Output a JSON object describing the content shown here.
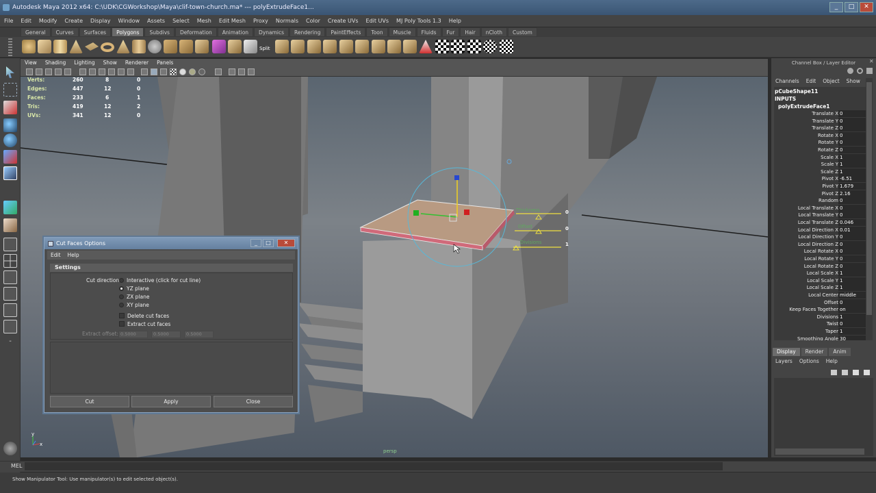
{
  "window": {
    "title": "Autodesk Maya 2012 x64: C:\\UDK\\CGWorkshop\\Maya\\clif-town-church.ma*  ---  polyExtrudeFace1...",
    "controls": [
      "_",
      "□",
      "✕"
    ]
  },
  "menubar": [
    "File",
    "Edit",
    "Modify",
    "Create",
    "Display",
    "Window",
    "Assets",
    "Select",
    "Mesh",
    "Edit Mesh",
    "Proxy",
    "Normals",
    "Color",
    "Create UVs",
    "Edit UVs",
    "MJ Poly Tools 1.3",
    "Help"
  ],
  "shelf_tabs": [
    "General",
    "Curves",
    "Surfaces",
    "Polygons",
    "Subdivs",
    "Deformation",
    "Animation",
    "Dynamics",
    "Rendering",
    "PaintEffects",
    "Toon",
    "Muscle",
    "Fluids",
    "Fur",
    "Hair",
    "nCloth",
    "Custom"
  ],
  "active_shelf_tab": "Polygons",
  "shelf_split_label": "Split",
  "viewport": {
    "menu": [
      "View",
      "Shading",
      "Lighting",
      "Show",
      "Renderer",
      "Panels"
    ],
    "camera_label": "persp",
    "hud": {
      "rows": [
        {
          "label": "Verts:",
          "a": "260",
          "b": "8",
          "c": "0"
        },
        {
          "label": "Edges:",
          "a": "447",
          "b": "12",
          "c": "0"
        },
        {
          "label": "Faces:",
          "a": "233",
          "b": "6",
          "c": "1"
        },
        {
          "label": "Tris:",
          "a": "419",
          "b": "12",
          "c": "2"
        },
        {
          "label": "UVs:",
          "a": "341",
          "b": "12",
          "c": "0"
        }
      ]
    },
    "manip": {
      "labels": [
        "Thickness",
        "Offset",
        "Divisions"
      ],
      "values": [
        "0",
        "0",
        "1"
      ]
    },
    "axis": {
      "y": "y",
      "x": "x"
    }
  },
  "channel_box": {
    "title": "Channel Box / Layer Editor",
    "menu": [
      "Channels",
      "Edit",
      "Object",
      "Show"
    ],
    "shape": "pCubeShape11",
    "inputs_label": "INPUTS",
    "node": "polyExtrudeFace1",
    "attrs": [
      {
        "label": "Translate X",
        "value": "0"
      },
      {
        "label": "Translate Y",
        "value": "0"
      },
      {
        "label": "Translate Z",
        "value": "0"
      },
      {
        "label": "Rotate X",
        "value": "0"
      },
      {
        "label": "Rotate Y",
        "value": "0"
      },
      {
        "label": "Rotate Z",
        "value": "0"
      },
      {
        "label": "Scale X",
        "value": "1"
      },
      {
        "label": "Scale Y",
        "value": "1"
      },
      {
        "label": "Scale Z",
        "value": "1"
      },
      {
        "label": "Pivot X",
        "value": "-6.51"
      },
      {
        "label": "Pivot Y",
        "value": "1.679"
      },
      {
        "label": "Pivot Z",
        "value": "2.16"
      },
      {
        "label": "Random",
        "value": "0"
      },
      {
        "label": "Local Translate X",
        "value": "0"
      },
      {
        "label": "Local Translate Y",
        "value": "0"
      },
      {
        "label": "Local Translate Z",
        "value": "0.046"
      },
      {
        "label": "Local Direction X",
        "value": "0.01"
      },
      {
        "label": "Local Direction Y",
        "value": "0"
      },
      {
        "label": "Local Direction Z",
        "value": "0"
      },
      {
        "label": "Local Rotate X",
        "value": "0"
      },
      {
        "label": "Local Rotate Y",
        "value": "0"
      },
      {
        "label": "Local Rotate Z",
        "value": "0"
      },
      {
        "label": "Local Scale X",
        "value": "1"
      },
      {
        "label": "Local Scale Y",
        "value": "1"
      },
      {
        "label": "Local Scale Z",
        "value": "1"
      },
      {
        "label": "Local Center",
        "value": "middle"
      },
      {
        "label": "Offset",
        "value": "0"
      },
      {
        "label": "Keep Faces Together",
        "value": "on"
      },
      {
        "label": "Divisions",
        "value": "1"
      },
      {
        "label": "Twist",
        "value": "0"
      },
      {
        "label": "Taper",
        "value": "1"
      },
      {
        "label": "Smoothing Angle",
        "value": "30"
      }
    ]
  },
  "layer_editor": {
    "tabs": [
      "Display",
      "Render",
      "Anim"
    ],
    "active_tab": "Display",
    "menu": [
      "Layers",
      "Options",
      "Help"
    ]
  },
  "dialog": {
    "title": "Cut Faces Options",
    "menu": [
      "Edit",
      "Help"
    ],
    "section": "Settings",
    "cut_direction_label": "Cut direction:",
    "options": [
      "Interactive (click for cut line)",
      "YZ plane",
      "ZX plane",
      "XY plane"
    ],
    "selected_option": "YZ plane",
    "checkboxes": [
      "Delete cut faces",
      "Extract cut faces"
    ],
    "extract_offset_label": "Extract offset:",
    "extract_offset_values": [
      "0.5000",
      "0.5000",
      "0.5000"
    ],
    "buttons": [
      "Cut",
      "Apply",
      "Close"
    ]
  },
  "mel_label": "MEL",
  "status_text": "Show Manipulator Tool: Use manipulator(s) to edit selected object(s)."
}
